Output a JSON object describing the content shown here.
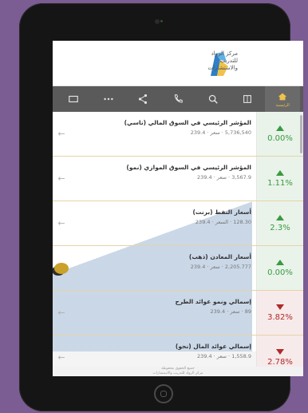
{
  "app": {
    "logo_lines": [
      "مركز الرواد",
      "للتدريب",
      "والاستشارات"
    ]
  },
  "toolbar": {
    "items": [
      {
        "icon": "window-icon",
        "label": ""
      },
      {
        "icon": "more-icon",
        "label": ""
      },
      {
        "icon": "share-icon",
        "label": ""
      },
      {
        "icon": "phone-icon",
        "label": ""
      },
      {
        "icon": "search-icon",
        "label": ""
      },
      {
        "icon": "book-icon",
        "label": ""
      },
      {
        "icon": "home-icon",
        "label": "الرئيسية"
      }
    ]
  },
  "rows": [
    {
      "name": "المؤشر الرئيسي في السوق المالي (تاسي)",
      "sub": "5,736,540 · سعر · 239.4",
      "pct": "0.00%",
      "dir": "up",
      "arrow": "←"
    },
    {
      "name": "المؤشر الرئيسي في السوق الموازي (نمو)",
      "sub": "3,567.9 · سعر · 239.4",
      "pct": "1.11%",
      "dir": "up",
      "arrow": "←"
    },
    {
      "name": "أسعار النفط (برنت)",
      "sub": "128.30 · السعر · 239.4",
      "pct": "2.3%",
      "dir": "up",
      "arrow": "←"
    },
    {
      "name": "أسعار المعادن (ذهب)",
      "sub": "2,205.777 · سعر · 239.4",
      "pct": "0.00%",
      "dir": "up",
      "arrow": ""
    },
    {
      "name": "إسمالي ونمو عوائد الطرح",
      "sub": "89 · سعر · 239.4",
      "pct": "3.82%",
      "dir": "down",
      "arrow": "←"
    },
    {
      "name": "إسمالي عوائد المال (نحو)",
      "sub": "1,558.9 · سعر · 239.4",
      "pct": "2.78%",
      "dir": "down",
      "arrow": "←"
    }
  ],
  "footer": {
    "line1": "جميع الحقوق محفوظة",
    "line2": "مركز الرواد للتدريب والاستشارات"
  },
  "colors": {
    "up": "#3a9a41",
    "down": "#b02a2a",
    "accent": "#f0c24a"
  }
}
